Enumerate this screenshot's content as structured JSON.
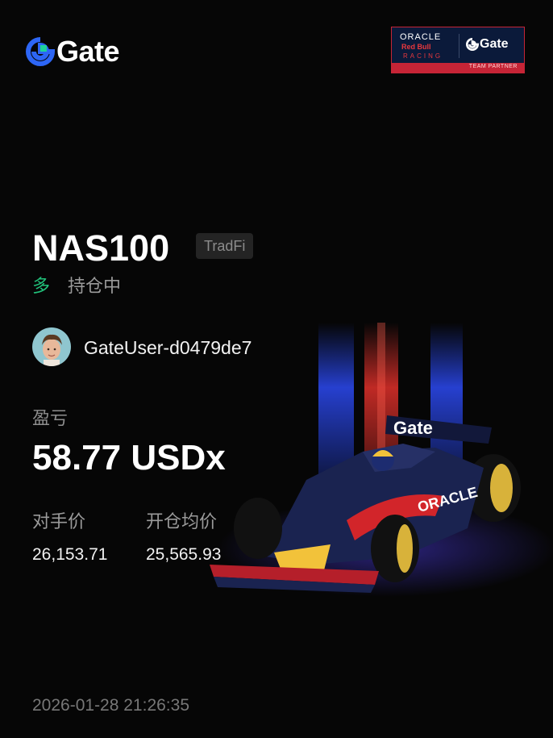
{
  "brand": {
    "name": "Gate",
    "logo_icon": "gate-logo-icon"
  },
  "partner": {
    "oracle": "ORACLE",
    "redbull": "Red Bull",
    "racing": "RACING",
    "gate": "Gate",
    "strip": "TEAM PARTNER"
  },
  "position": {
    "symbol": "NAS100",
    "tag": "TradFi",
    "side": "多",
    "side_color": "#21c17a",
    "status": "持仓中"
  },
  "user": {
    "name": "GateUser-d0479de7"
  },
  "pnl": {
    "label": "盈亏",
    "value": "58.77 USDx"
  },
  "prices": {
    "counterparty_label": "对手价",
    "counterparty_value": "26,153.71",
    "avg_open_label": "开仓均价",
    "avg_open_value": "25,565.93"
  },
  "timestamp": "2026-01-28 21:26:35",
  "car_livery": {
    "car_gate": "Gate",
    "car_oracle": "ORACLE"
  }
}
